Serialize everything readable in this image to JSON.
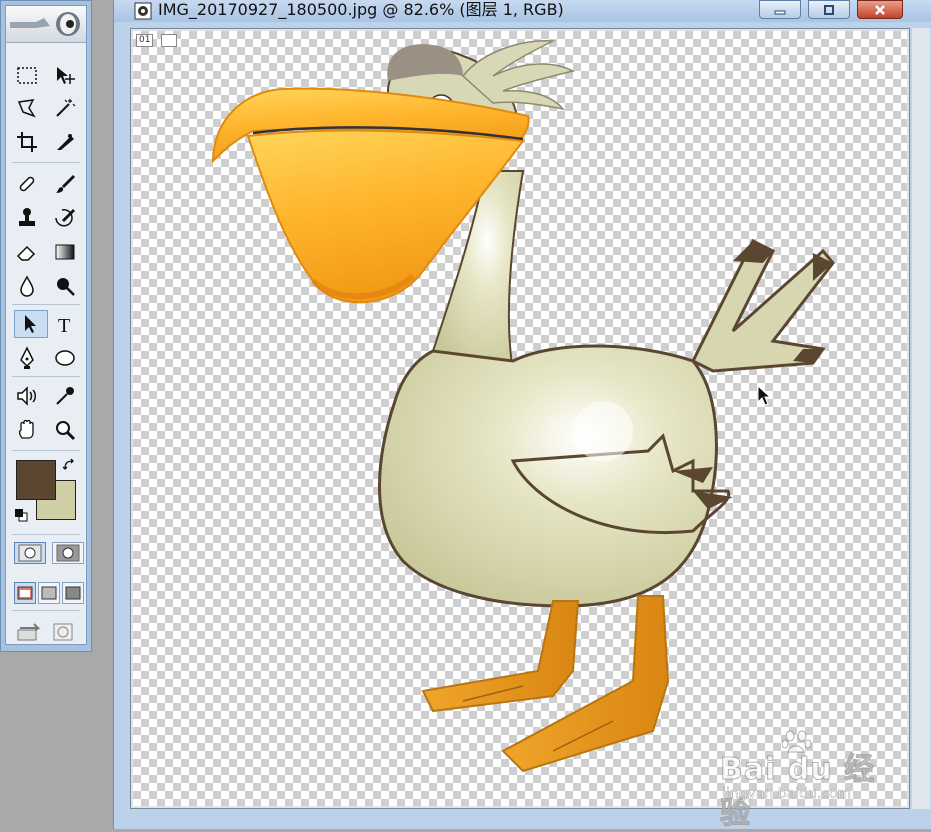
{
  "window": {
    "title": "IMG_20170927_180500.jpg @ 82.6% (图层 1, RGB)",
    "controls": {
      "minimize": "minimize",
      "restore": "restore",
      "close": "close"
    }
  },
  "canvas": {
    "layer_tag": "01",
    "content": "cartoon-pelican"
  },
  "toolbox": {
    "tools": [
      "rectangular-marquee-icon",
      "move-icon",
      "lasso-icon",
      "magic-wand-icon",
      "crop-icon",
      "slice-icon",
      "healing-brush-icon",
      "brush-icon",
      "clone-stamp-icon",
      "history-brush-icon",
      "eraser-icon",
      "gradient-icon",
      "blur-icon",
      "dodge-icon",
      "path-selection-icon",
      "type-icon",
      "pen-icon",
      "ellipse-shape-icon",
      "notes-icon",
      "eyedropper-icon",
      "hand-icon",
      "zoom-icon"
    ],
    "selected_tool": "path-selection-icon",
    "foreground_color": "#5b4731",
    "background_color": "#cfcfa6"
  },
  "watermark": {
    "brand": "Bai du 经验",
    "url": "jingyan.baidu.com"
  },
  "colors": {
    "titlebar": "#b3cbe8",
    "toolbox": "#a6c2e1",
    "close_button": "#c6402a"
  }
}
